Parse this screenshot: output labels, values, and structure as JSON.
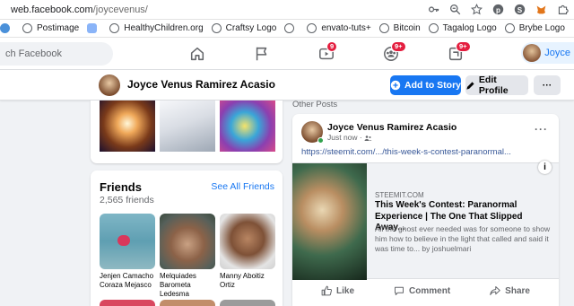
{
  "browser": {
    "url_host": "web.facebook.com",
    "url_path": "/joycevenus/"
  },
  "bookmarks": [
    {
      "label": "Postimage",
      "icon": "globe-icon"
    },
    {
      "label": "",
      "icon": "cloud-icon"
    },
    {
      "label": "HealthyChildren.org",
      "icon": "globe-icon"
    },
    {
      "label": "Craftsy Logo",
      "icon": "globe-icon"
    },
    {
      "label": "",
      "icon": "globe-icon"
    },
    {
      "label": "envato-tuts+",
      "icon": "globe-icon"
    },
    {
      "label": "Bitcoin",
      "icon": "globe-icon"
    },
    {
      "label": "Tagalog Logo",
      "icon": "globe-icon"
    },
    {
      "label": "Brybe Logo",
      "icon": "globe-icon"
    }
  ],
  "nav": {
    "search_placeholder": "ch Facebook",
    "watch_badge": "9",
    "groups_badge": "9+",
    "gaming_badge": "9+",
    "me_label": "Joyce"
  },
  "profile_bar": {
    "name": "Joyce Venus Ramirez Acasio",
    "add_story": "Add to Story",
    "edit_profile": "Edit Profile",
    "more": "···"
  },
  "friends": {
    "title": "Friends",
    "count": "2,565 friends",
    "see_all": "See All Friends",
    "list": [
      {
        "name": "Jenjen Camacho Coraza Mejasco"
      },
      {
        "name": "Melquiades Barometa Ledesma"
      },
      {
        "name": "Manny Aboitiz Ortiz"
      }
    ]
  },
  "posts": {
    "section_label": "Other Posts",
    "author": "Joyce Venus Ramirez Acasio",
    "time": "Just now ·",
    "link": "https://steemit.com/.../this-week-s-contest-paranormal...",
    "preview": {
      "site": "STEEMIT.COM",
      "title": "This Week's Contest: Paranormal Experience | The One That Slipped Away...",
      "description": "All the ghost ever needed was for someone to show him how to believe in the light that called and said it was time to... by joshuelmari"
    },
    "actions": {
      "like": "Like",
      "comment": "Comment",
      "share": "Share"
    }
  },
  "colors": {
    "brand_blue": "#1877f2",
    "badge_red": "#e41e3f",
    "background": "#f0f2f5"
  }
}
